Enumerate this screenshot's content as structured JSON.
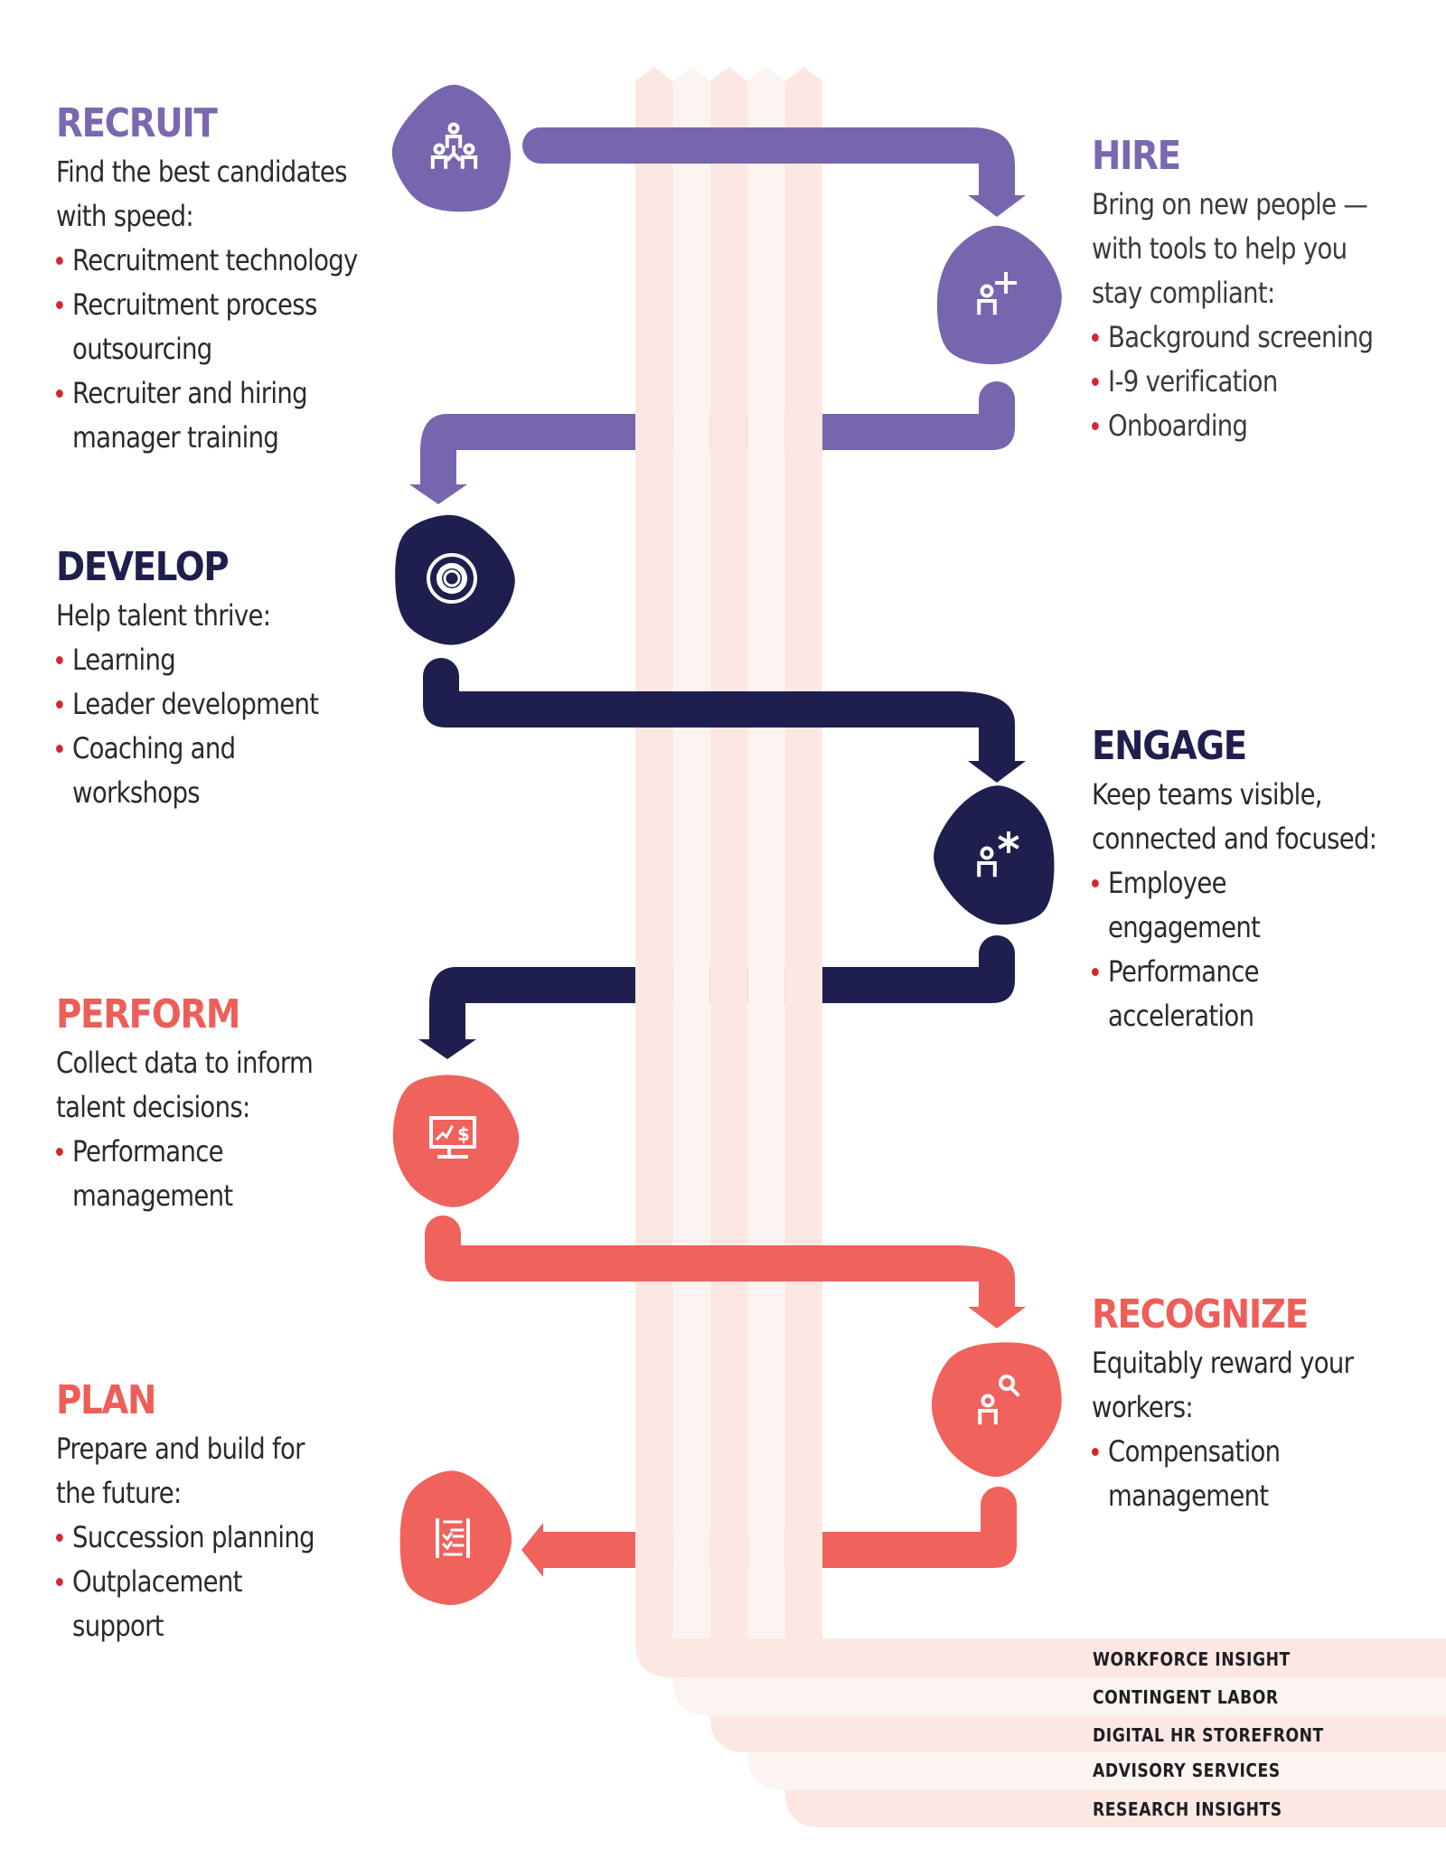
{
  "colors": {
    "purple": "#7766ae",
    "navy": "#1e1f4e",
    "coral": "#f0625c",
    "stripe_pink": "#fde7e3",
    "stripe_cream": "#fbf4f0",
    "bullet_red": "#d7262e"
  },
  "stages": [
    {
      "id": "recruit",
      "title": "RECRUIT",
      "lead": [
        "Find the best candidates",
        "with speed:"
      ],
      "bullets": [
        [
          "Recruitment technology"
        ],
        [
          "Recruitment process",
          "outsourcing"
        ],
        [
          "Recruiter and hiring",
          "manager training"
        ]
      ],
      "icon": "org-chart-people-icon"
    },
    {
      "id": "hire",
      "title": "HIRE",
      "lead": [
        "Bring on new people —",
        "with tools to help you",
        "stay compliant:"
      ],
      "bullets": [
        [
          "Background screening"
        ],
        [
          "I-9 verification"
        ],
        [
          "Onboarding"
        ]
      ],
      "icon": "add-person-icon"
    },
    {
      "id": "develop",
      "title": "DEVELOP",
      "lead": [
        "Help talent thrive:"
      ],
      "bullets": [
        [
          "Learning"
        ],
        [
          "Leader development"
        ],
        [
          "Coaching and",
          "workshops"
        ]
      ],
      "icon": "gear-cycle-icon"
    },
    {
      "id": "engage",
      "title": "ENGAGE",
      "lead": [
        "Keep teams visible,",
        "connected and focused:"
      ],
      "bullets": [
        [
          "Employee",
          "engagement"
        ],
        [
          "Performance",
          "acceleration"
        ]
      ],
      "icon": "person-star-icon"
    },
    {
      "id": "perform",
      "title": "PERFORM",
      "lead": [
        "Collect data to inform",
        "talent decisions:"
      ],
      "bullets": [
        [
          "Performance",
          "management"
        ]
      ],
      "icon": "monitor-dollar-chart-icon"
    },
    {
      "id": "recognize",
      "title": "RECOGNIZE",
      "lead": [
        "Equitably reward your",
        "workers:"
      ],
      "bullets": [
        [
          "Compensation",
          "management"
        ]
      ],
      "icon": "person-search-icon"
    },
    {
      "id": "plan",
      "title": "PLAN",
      "lead": [
        "Prepare and build for",
        "the future:"
      ],
      "bullets": [
        [
          "Succession planning"
        ],
        [
          "Outplacement",
          "support"
        ]
      ],
      "icon": "checklist-icon"
    }
  ],
  "foundation_rows": [
    "WORKFORCE INSIGHT",
    "CONTINGENT LABOR",
    "DIGITAL HR STOREFRONT",
    "ADVISORY SERVICES",
    "RESEARCH INSIGHTS"
  ]
}
